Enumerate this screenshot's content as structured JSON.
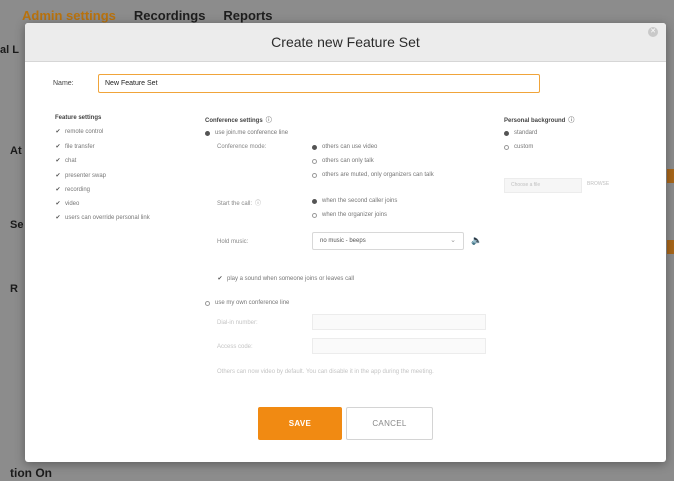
{
  "background": {
    "tabs": [
      "Admin settings",
      "Recordings",
      "Reports"
    ],
    "side_fragments": [
      "al L",
      "At",
      "Se",
      "R"
    ],
    "bottom_text": "tion On"
  },
  "modal": {
    "title": "Create new Feature Set",
    "name_label": "Name:",
    "name_value": "New Feature Set",
    "feature_settings": {
      "title": "Feature settings",
      "items": [
        "remote control",
        "file transfer",
        "chat",
        "presenter swap",
        "recording",
        "video",
        "users can override personal link"
      ]
    },
    "conference_settings": {
      "title": "Conference settings",
      "use_joinme_line": "use join.me conference line",
      "conference_mode_label": "Conference mode:",
      "conference_mode_options": [
        "others can use video",
        "others can only talk",
        "others are muted, only organizers can talk"
      ],
      "start_call_label": "Start the call:",
      "start_call_options": [
        "when the second caller joins",
        "when the organizer joins"
      ],
      "hold_music_label": "Hold music:",
      "hold_music_value": "no music - beeps",
      "play_sound_label": "play a sound when someone joins or leaves call",
      "use_own_line": "use my own conference line",
      "dial_in_label": "Dial-in number:",
      "access_code_label": "Access code:",
      "note": "Others can now video by default. You can disable it in the app during the meeting."
    },
    "personal_background": {
      "title": "Personal background",
      "options": [
        "standard",
        "custom"
      ],
      "choose_file": "Choose a file",
      "browse": "BROWSE"
    },
    "save_label": "SAVE",
    "cancel_label": "CANCEL"
  },
  "icons": {
    "info": "ⓘ",
    "check": "✔",
    "chevron": "⌄",
    "speaker": "🔈",
    "close": "✕"
  }
}
